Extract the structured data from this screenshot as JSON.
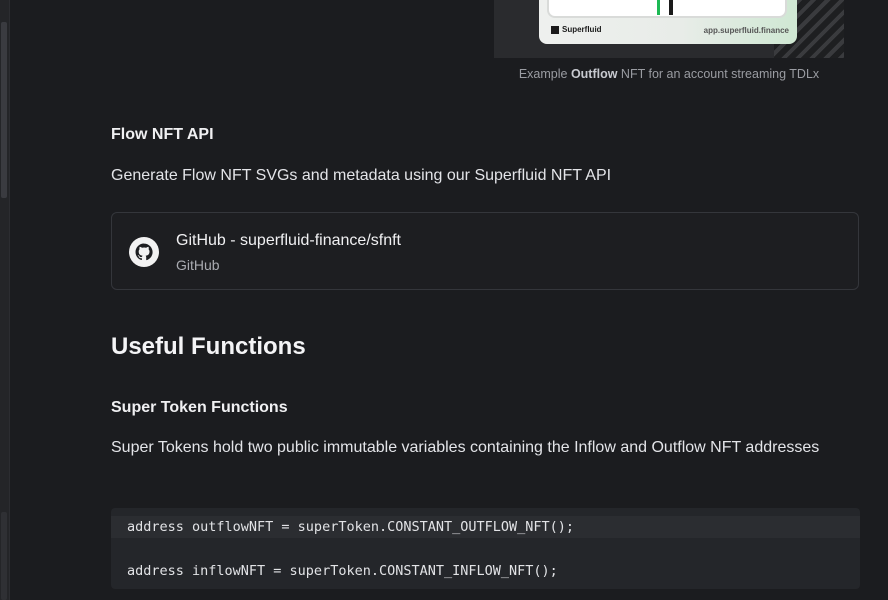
{
  "figure": {
    "card_brand": "Superfluid",
    "card_domain": "app.superfluid.finance",
    "caption_prefix": "Example ",
    "caption_bold": "Outflow",
    "caption_suffix": " NFT for an account streaming TDLx"
  },
  "flow_nft_api": {
    "heading": "Flow NFT API",
    "description": "Generate Flow NFT SVGs and metadata using our Superfluid NFT API",
    "link_card": {
      "icon": "github-icon",
      "title": "GitHub - superfluid-finance/sfnft",
      "subtitle": "GitHub"
    }
  },
  "useful_functions": {
    "heading": "Useful Functions",
    "super_token_functions": {
      "heading": "Super Token Functions",
      "description": "Super Tokens hold two public immutable variables containing the Inflow and Outflow NFT addresses",
      "code_lines": [
        "address outflowNFT = superToken.CONSTANT_OUTFLOW_NFT();",
        "",
        "address inflowNFT = superToken.CONSTANT_INFLOW_NFT();"
      ]
    }
  },
  "colors": {
    "background": "#1b1c1f",
    "code_background": "#24262a",
    "text": "#e3e4e8",
    "muted": "#9a9ca2"
  }
}
